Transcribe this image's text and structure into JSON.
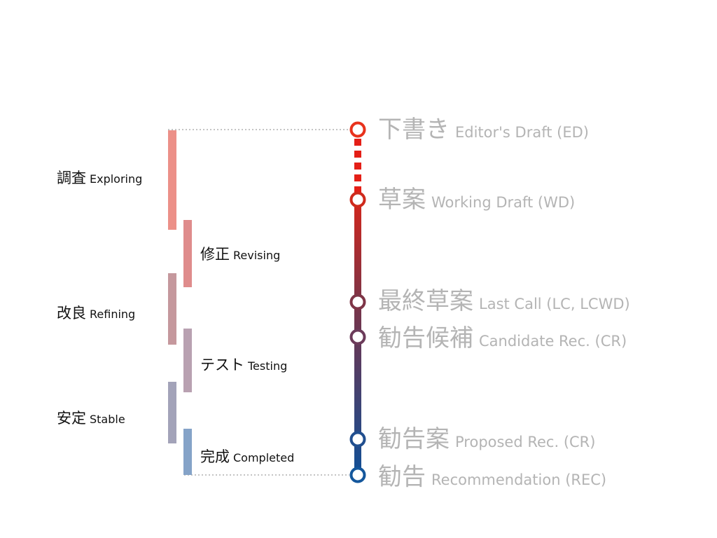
{
  "phases_left": [
    {
      "ja": "調査",
      "en": "Exploring",
      "color": "#ec9088"
    },
    {
      "ja": "改良",
      "en": "Refining",
      "color": "#c5989d"
    },
    {
      "ja": "安定",
      "en": "Stable",
      "color": "#a3a3b9"
    }
  ],
  "phases_right": [
    {
      "ja": "修正",
      "en": "Revising",
      "color": "#df8c8c"
    },
    {
      "ja": "テスト",
      "en": "Testing",
      "color": "#b9a1b1"
    },
    {
      "ja": "完成",
      "en": "Completed",
      "color": "#85a3c8"
    }
  ],
  "stages": [
    {
      "ja": "下書き",
      "en": "Editor's Draft (ED)",
      "color": "#e8321c"
    },
    {
      "ja": "草案",
      "en": "Working Draft (WD)",
      "color": "#cf2a1c"
    },
    {
      "ja": "最終草案",
      "en": "Last Call (LC, LCWD)",
      "color": "#7e3547"
    },
    {
      "ja": "勧告候補",
      "en": "Candidate Rec. (CR)",
      "color": "#6c3b5a"
    },
    {
      "ja": "勧告案",
      "en": "Proposed Rec. (CR)",
      "color": "#214f8f"
    },
    {
      "ja": "勧告",
      "en": "Recommendation (REC)",
      "color": "#14579c"
    }
  ],
  "colors": {
    "track_top": "#d2261c",
    "track_mid": "#7a3448",
    "track_bottom": "#104f96",
    "dash": "#e41f17",
    "guide": "#888888",
    "stage_text": "#b4b4b4"
  }
}
